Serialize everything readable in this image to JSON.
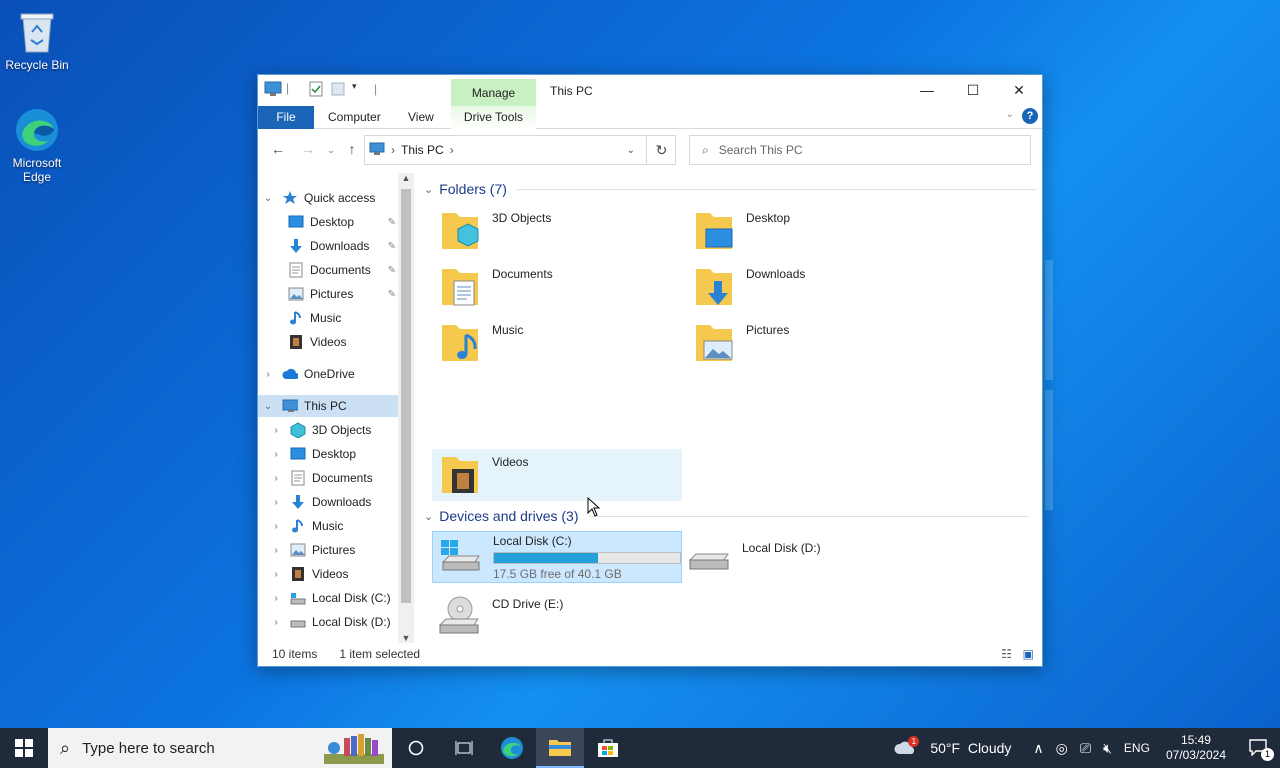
{
  "desktop": {
    "icons": [
      {
        "label": "Recycle Bin"
      },
      {
        "label": "Microsoft Edge"
      }
    ]
  },
  "window": {
    "title": "This PC",
    "manage_tab": "Manage",
    "ribbon_tabs": {
      "file": "File",
      "computer": "Computer",
      "view": "View",
      "drive_tools": "Drive Tools"
    },
    "address": {
      "segments": [
        "This PC"
      ]
    },
    "search": {
      "placeholder": "Search This PC"
    },
    "nav": {
      "quick_access": "Quick access",
      "quick_items": [
        "Desktop",
        "Downloads",
        "Documents",
        "Pictures",
        "Music",
        "Videos"
      ],
      "onedrive": "OneDrive",
      "this_pc": "This PC",
      "pc_items": [
        "3D Objects",
        "Desktop",
        "Documents",
        "Downloads",
        "Music",
        "Pictures",
        "Videos",
        "Local Disk (C:)",
        "Local Disk (D:)"
      ]
    },
    "folders_header": "Folders (7)",
    "folders": [
      "3D Objects",
      "Desktop",
      "Documents",
      "Downloads",
      "Music",
      "Pictures",
      "Videos"
    ],
    "drives_header": "Devices and drives (3)",
    "drives": [
      {
        "name": "Local Disk (C:)",
        "free": "17.5 GB free of 40.1 GB",
        "used_fraction": 0.56
      },
      {
        "name": "Local Disk (D:)"
      },
      {
        "name": "CD Drive (E:)"
      }
    ],
    "status": {
      "count": "10 items",
      "selected": "1 item selected"
    }
  },
  "taskbar": {
    "search_placeholder": "Type here to search",
    "weather": "50°F  Cloudy",
    "weather_badge": "1",
    "language": "ENG",
    "time": "15:49",
    "date": "07/03/2024",
    "notif_count": "1"
  },
  "colors": {
    "accent": "#1b65b8",
    "selection": "#cce8ff",
    "drive_fill": "#26a0da"
  }
}
